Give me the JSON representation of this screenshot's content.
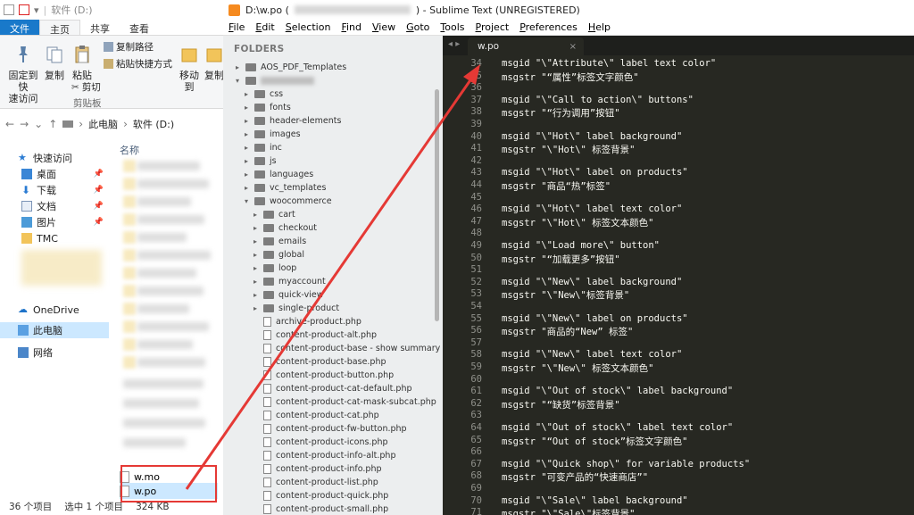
{
  "explorer": {
    "title_path": "软件 (D:)",
    "tabs": [
      "文件",
      "主页",
      "共享",
      "查看"
    ],
    "ribbon": {
      "pin_label_1": "固定到快",
      "pin_label_2": "速访问",
      "copy_label": "复制",
      "paste_label": "粘贴",
      "copy_path": "复制路径",
      "paste_shortcut": "粘贴快捷方式",
      "cut": "剪切",
      "clipboard_group": "剪贴板",
      "move_to": "移动到",
      "copy_to": "复制"
    },
    "address": [
      "此电脑",
      "软件 (D:)"
    ],
    "nav": [
      {
        "label": "快速访问",
        "icon": "star-icon"
      },
      {
        "label": "桌面",
        "icon": "desktop-icon"
      },
      {
        "label": "下载",
        "icon": "download-icon"
      },
      {
        "label": "文档",
        "icon": "document-icon"
      },
      {
        "label": "图片",
        "icon": "picture-icon"
      },
      {
        "label": "TMC",
        "icon": "folder-icon"
      },
      {
        "label": "OneDrive",
        "icon": "cloud-icon"
      },
      {
        "label": "此电脑",
        "icon": "computer-icon"
      },
      {
        "label": "网络",
        "icon": "network-icon"
      }
    ],
    "column_name": "名称",
    "files": [
      {
        "name": "w.mo"
      },
      {
        "name": "w.po"
      }
    ],
    "status": {
      "count": "36 个项目",
      "selected": "选中 1 个项目",
      "size": "324 KB"
    }
  },
  "sublime": {
    "title": "D:\\w.po (",
    "title_suffix": ") - Sublime Text (UNREGISTERED)",
    "menu": [
      "File",
      "Edit",
      "Selection",
      "Find",
      "View",
      "Goto",
      "Tools",
      "Project",
      "Preferences",
      "Help"
    ],
    "folders_header": "FOLDERS",
    "tree": [
      {
        "label": "AOS_PDF_Templates",
        "kind": "folder",
        "depth": 0,
        "open": false
      },
      {
        "label": "",
        "kind": "folder",
        "depth": 0,
        "open": true
      },
      {
        "label": "css",
        "kind": "folder",
        "depth": 1
      },
      {
        "label": "fonts",
        "kind": "folder",
        "depth": 1
      },
      {
        "label": "header-elements",
        "kind": "folder",
        "depth": 1
      },
      {
        "label": "images",
        "kind": "folder",
        "depth": 1
      },
      {
        "label": "inc",
        "kind": "folder",
        "depth": 1
      },
      {
        "label": "js",
        "kind": "folder",
        "depth": 1
      },
      {
        "label": "languages",
        "kind": "folder",
        "depth": 1
      },
      {
        "label": "vc_templates",
        "kind": "folder",
        "depth": 1
      },
      {
        "label": "woocommerce",
        "kind": "folder",
        "depth": 1,
        "open": true
      },
      {
        "label": "cart",
        "kind": "folder",
        "depth": 2
      },
      {
        "label": "checkout",
        "kind": "folder",
        "depth": 2
      },
      {
        "label": "emails",
        "kind": "folder",
        "depth": 2
      },
      {
        "label": "global",
        "kind": "folder",
        "depth": 2
      },
      {
        "label": "loop",
        "kind": "folder",
        "depth": 2
      },
      {
        "label": "myaccount",
        "kind": "folder",
        "depth": 2
      },
      {
        "label": "quick-view",
        "kind": "folder",
        "depth": 2
      },
      {
        "label": "single-product",
        "kind": "folder",
        "depth": 2
      },
      {
        "label": "archive-product.php",
        "kind": "file",
        "depth": 2
      },
      {
        "label": "content-product-alt.php",
        "kind": "file",
        "depth": 2
      },
      {
        "label": "content-product-base - show summary on hc",
        "kind": "file",
        "depth": 2
      },
      {
        "label": "content-product-base.php",
        "kind": "file",
        "depth": 2
      },
      {
        "label": "content-product-button.php",
        "kind": "file",
        "depth": 2
      },
      {
        "label": "content-product-cat-default.php",
        "kind": "file",
        "depth": 2
      },
      {
        "label": "content-product-cat-mask-subcat.php",
        "kind": "file",
        "depth": 2
      },
      {
        "label": "content-product-cat.php",
        "kind": "file",
        "depth": 2
      },
      {
        "label": "content-product-fw-button.php",
        "kind": "file",
        "depth": 2
      },
      {
        "label": "content-product-icons.php",
        "kind": "file",
        "depth": 2
      },
      {
        "label": "content-product-info-alt.php",
        "kind": "file",
        "depth": 2
      },
      {
        "label": "content-product-info.php",
        "kind": "file",
        "depth": 2
      },
      {
        "label": "content-product-list.php",
        "kind": "file",
        "depth": 2
      },
      {
        "label": "content-product-quick.php",
        "kind": "file",
        "depth": 2
      },
      {
        "label": "content-product-small.php",
        "kind": "file",
        "depth": 2
      }
    ],
    "tab_nav": "◂ ▸",
    "tab_label": "w.po",
    "tab_close": "×",
    "lines": [
      {
        "n": "34",
        "t": "msgid \"\\\"Attribute\\\" label text color\""
      },
      {
        "n": "35",
        "t": "msgstr \"“属性”标签文字颜色\""
      },
      {
        "n": "36",
        "t": ""
      },
      {
        "n": "37",
        "t": "msgid \"\\\"Call to action\\\" buttons\""
      },
      {
        "n": "38",
        "t": "msgstr \"“行为调用”按钮\""
      },
      {
        "n": "39",
        "t": ""
      },
      {
        "n": "40",
        "t": "msgid \"\\\"Hot\\\" label background\""
      },
      {
        "n": "41",
        "t": "msgstr \"\\\"Hot\\\" 标签背景\""
      },
      {
        "n": "42",
        "t": ""
      },
      {
        "n": "43",
        "t": "msgid \"\\\"Hot\\\" label on products\""
      },
      {
        "n": "44",
        "t": "msgstr \"商品“热”标签\""
      },
      {
        "n": "45",
        "t": ""
      },
      {
        "n": "46",
        "t": "msgid \"\\\"Hot\\\" label text color\""
      },
      {
        "n": "47",
        "t": "msgstr \"\\\"Hot\\\" 标签文本颜色\""
      },
      {
        "n": "48",
        "t": ""
      },
      {
        "n": "49",
        "t": "msgid \"\\\"Load more\\\" button\""
      },
      {
        "n": "50",
        "t": "msgstr \"“加载更多”按钮\""
      },
      {
        "n": "51",
        "t": ""
      },
      {
        "n": "52",
        "t": "msgid \"\\\"New\\\" label background\""
      },
      {
        "n": "53",
        "t": "msgstr \"\\\"New\\\"标签背景\""
      },
      {
        "n": "54",
        "t": ""
      },
      {
        "n": "55",
        "t": "msgid \"\\\"New\\\" label on products\""
      },
      {
        "n": "56",
        "t": "msgstr \"商品的“New” 标签\""
      },
      {
        "n": "57",
        "t": ""
      },
      {
        "n": "58",
        "t": "msgid \"\\\"New\\\" label text color\""
      },
      {
        "n": "59",
        "t": "msgstr \"\\\"New\\\" 标签文本颜色\""
      },
      {
        "n": "60",
        "t": ""
      },
      {
        "n": "61",
        "t": "msgid \"\\\"Out of stock\\\" label background\""
      },
      {
        "n": "62",
        "t": "msgstr \"“缺货”标签背景\""
      },
      {
        "n": "63",
        "t": ""
      },
      {
        "n": "64",
        "t": "msgid \"\\\"Out of stock\\\" label text color\""
      },
      {
        "n": "65",
        "t": "msgstr \"“Out of stock”标签文字颜色\""
      },
      {
        "n": "66",
        "t": ""
      },
      {
        "n": "67",
        "t": "msgid \"\\\"Quick shop\\\" for variable products\""
      },
      {
        "n": "68",
        "t": "msgstr \"可变产品的“快速商店”\""
      },
      {
        "n": "69",
        "t": ""
      },
      {
        "n": "70",
        "t": "msgid \"\\\"Sale\\\" label background\""
      },
      {
        "n": "71",
        "t": "msgstr \"\\\"Sale\\\"标签背景\""
      }
    ]
  },
  "colors": {
    "editor_bg": "#272822",
    "annotation": "#e53935",
    "accent": "#1979ca"
  }
}
